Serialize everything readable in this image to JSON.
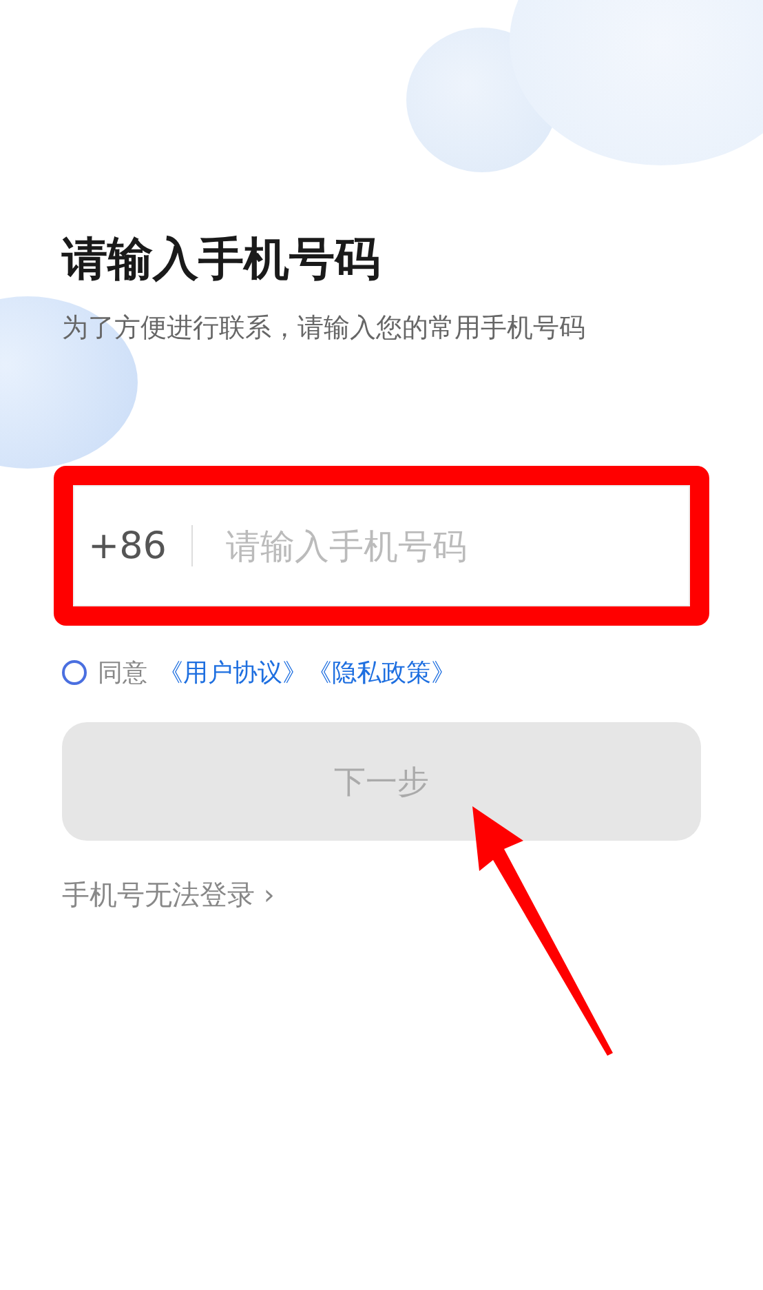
{
  "title": "请输入手机号码",
  "subtitle": "为了方便进行联系，请输入您的常用手机号码",
  "phone": {
    "country_code": "+86",
    "placeholder": "请输入手机号码"
  },
  "agreement": {
    "checked": false,
    "label": "同意",
    "links": [
      "《用户协议》",
      "《隐私政策》"
    ]
  },
  "next_button": {
    "label": "下一步",
    "disabled": true
  },
  "help_link": {
    "label": "手机号无法登录",
    "arrow": "›"
  }
}
